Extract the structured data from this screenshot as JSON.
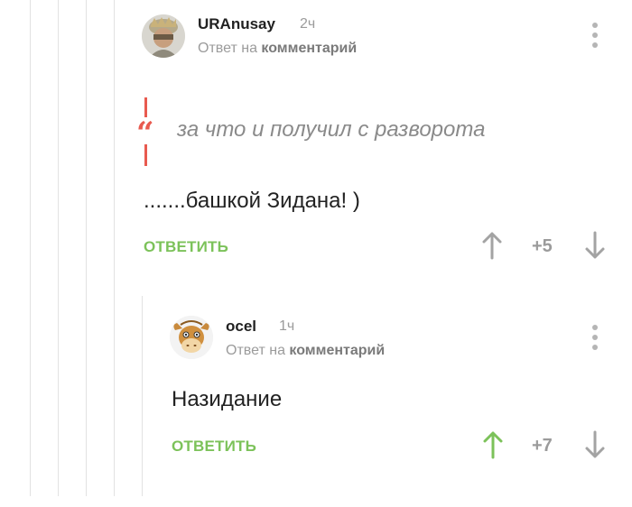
{
  "comments": [
    {
      "author": "URAnusay",
      "time": "2ч",
      "reply_prefix": "Ответ на",
      "reply_target": "комментарий",
      "quote": "за что и получил с разворота",
      "quote_mark": "“",
      "text": ".......башкой Зидана! )",
      "reply_label": "ОТВЕТИТЬ",
      "rating": "+5",
      "upvoted": false
    },
    {
      "author": "ocel",
      "time": "1ч",
      "reply_prefix": "Ответ на",
      "reply_target": "комментарий",
      "text": "Назидание",
      "reply_label": "ОТВЕТИТЬ",
      "rating": "+7",
      "upvoted": true
    }
  ],
  "colors": {
    "accent_green": "#7cc25a",
    "quote_red": "#e85a4f",
    "muted_gray": "#9b9b9b",
    "vote_gray": "#a3a3a3"
  },
  "icons": {
    "upvote": "arrow-up-icon",
    "downvote": "arrow-down-icon",
    "menu": "more-vertical-icon"
  }
}
